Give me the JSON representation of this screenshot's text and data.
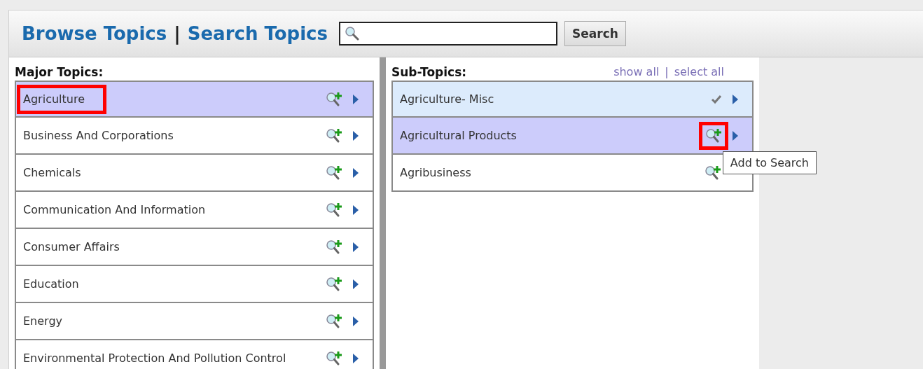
{
  "header": {
    "browse_link": "Browse Topics",
    "separator": "|",
    "search_link": "Search Topics",
    "search_button": "Search"
  },
  "major_topics": {
    "title": "Major Topics:",
    "items": [
      {
        "label": "Agriculture",
        "selected": true,
        "outlined": true
      },
      {
        "label": "Business And Corporations",
        "selected": false,
        "outlined": false
      },
      {
        "label": "Chemicals",
        "selected": false,
        "outlined": false
      },
      {
        "label": "Communication And Information",
        "selected": false,
        "outlined": false
      },
      {
        "label": "Consumer Affairs",
        "selected": false,
        "outlined": false
      },
      {
        "label": "Education",
        "selected": false,
        "outlined": false
      },
      {
        "label": "Energy",
        "selected": false,
        "outlined": false
      },
      {
        "label": "Environmental Protection And Pollution Control",
        "selected": false,
        "outlined": false
      }
    ]
  },
  "sub_topics": {
    "title": "Sub-Topics:",
    "show_all": "show all",
    "divider": "|",
    "select_all": "select all",
    "items": [
      {
        "label": "Agriculture- Misc",
        "selected": false,
        "checked": true,
        "outlined": false
      },
      {
        "label": "Agricultural Products",
        "selected": true,
        "checked": false,
        "outlined": true,
        "tooltip": "Add to Search"
      },
      {
        "label": "Agribusiness",
        "selected": false,
        "checked": false,
        "outlined": false
      }
    ]
  }
}
